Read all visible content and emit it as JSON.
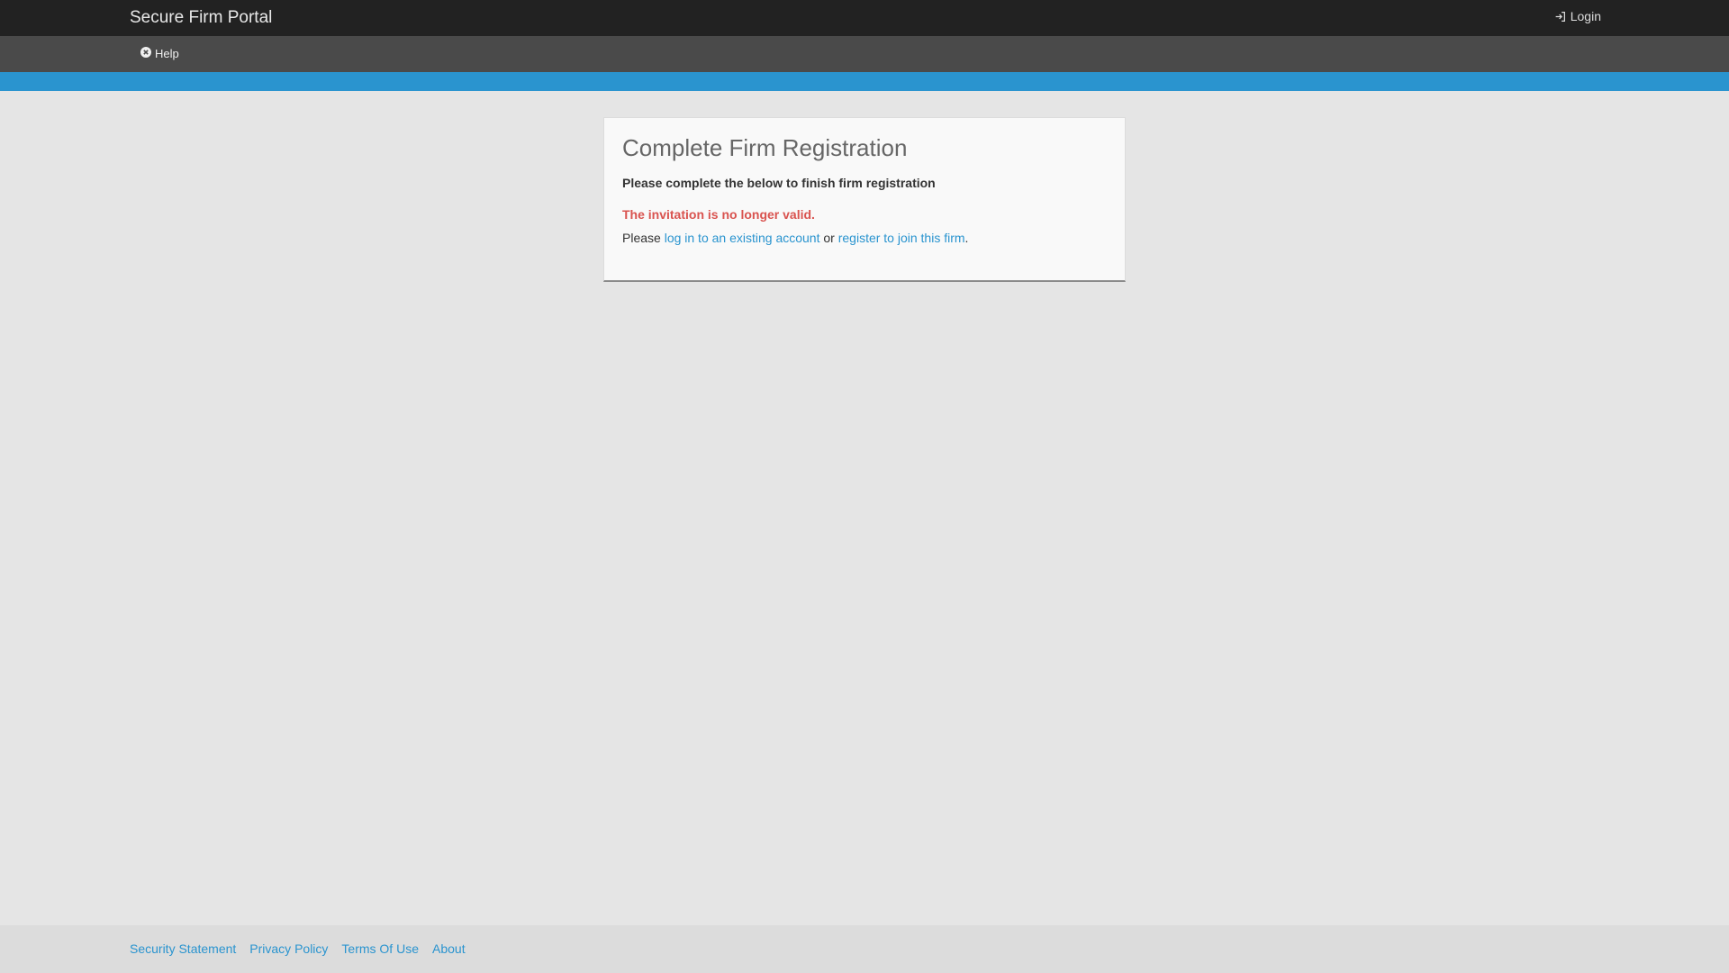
{
  "header": {
    "brand": "Secure Firm Portal",
    "login_label": "Login",
    "login_icon": "sign-in-icon"
  },
  "subnav": {
    "help_label": "Help",
    "help_icon": "times-circle-icon"
  },
  "colors": {
    "accent": "#2a94cf",
    "error": "#d9534f",
    "topbar": "#222222",
    "subbar": "#4a4a4a"
  },
  "main": {
    "title": "Complete Firm Registration",
    "subtitle": "Please complete the below to finish firm registration",
    "error": "The invitation is no longer valid.",
    "instruction_prefix": "Please",
    "login_link": "log in to an existing account",
    "instruction_middle": "or",
    "register_link": "register to join this firm",
    "instruction_suffix": "."
  },
  "footer": {
    "links": [
      "Security Statement",
      "Privacy Policy",
      "Terms Of Use",
      "About"
    ]
  }
}
